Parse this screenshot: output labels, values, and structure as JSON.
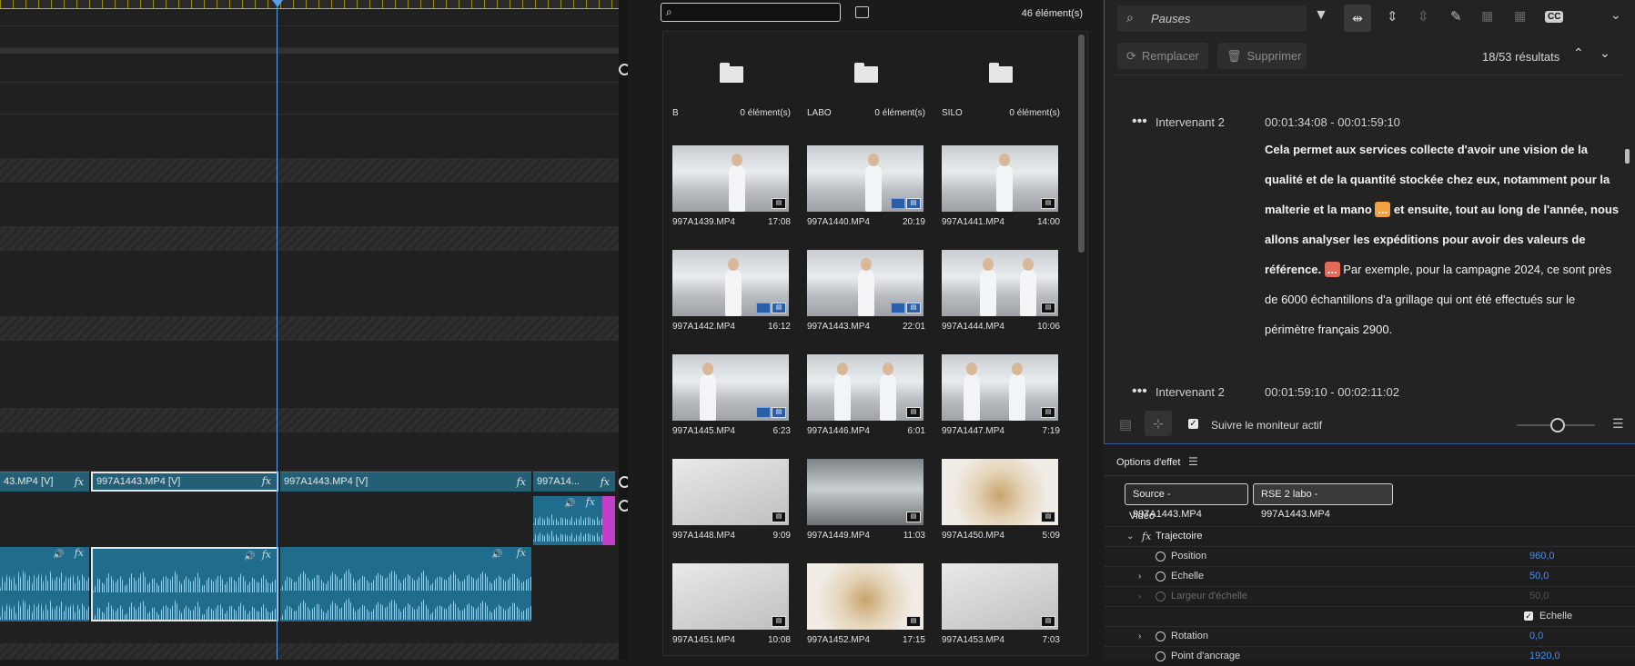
{
  "timeline": {
    "video_clips": [
      {
        "label": "43.MP4 [V]",
        "fx": "fx"
      },
      {
        "label": "997A1443.MP4 [V]",
        "fx": "fx"
      },
      {
        "label": "997A1443.MP4 [V]",
        "fx": "fx"
      },
      {
        "label": "997A14...",
        "fx": "fx"
      }
    ],
    "audio_fx": "fx"
  },
  "bin": {
    "search_placeholder": "",
    "count": "46 élément(s)",
    "folders": [
      {
        "name": "B",
        "count": "0 élément(s)"
      },
      {
        "name": "LABO",
        "count": "0 élément(s)"
      },
      {
        "name": "SILO",
        "count": "0 élément(s)"
      }
    ],
    "clips": [
      {
        "name": "997A1439.MP4",
        "duration": "17:08"
      },
      {
        "name": "997A1440.MP4",
        "duration": "20:19"
      },
      {
        "name": "997A1441.MP4",
        "duration": "14:00"
      },
      {
        "name": "997A1442.MP4",
        "duration": "16:12"
      },
      {
        "name": "997A1443.MP4",
        "duration": "22:01"
      },
      {
        "name": "997A1444.MP4",
        "duration": "10:06"
      },
      {
        "name": "997A1445.MP4",
        "duration": "6:23"
      },
      {
        "name": "997A1446.MP4",
        "duration": "6:01"
      },
      {
        "name": "997A1447.MP4",
        "duration": "7:19"
      },
      {
        "name": "997A1448.MP4",
        "duration": "9:09"
      },
      {
        "name": "997A1449.MP4",
        "duration": "11:03"
      },
      {
        "name": "997A1450.MP4",
        "duration": "5:09"
      },
      {
        "name": "997A1451.MP4",
        "duration": "10:08"
      },
      {
        "name": "997A1452.MP4",
        "duration": "17:15"
      },
      {
        "name": "997A1453.MP4",
        "duration": "7:03"
      }
    ]
  },
  "transcript": {
    "search_value": "Pauses",
    "replace_label": "Remplacer",
    "delete_label": "Supprimer",
    "results": "18/53 résultats",
    "segments": [
      {
        "speaker": "Intervenant 2",
        "time": "00:01:34:08 - 00:01:59:10",
        "part1": "Cela permet aux services collecte d'avoir une vision de la qualité et de la quantité stockée chez eux, notamment pour la malterie et la mano ",
        "pause1": "...",
        "part2": " et ensuite, tout au long de l'année, nous allons analyser les expéditions pour avoir des valeurs de référence. ",
        "pause2": "...",
        "part3": " Par exemple, pour la campagne 2024, ce sont près de 6000 échantillons d'a grillage qui ont été effectués sur le périmètre français 2900."
      },
      {
        "speaker": "Intervenant 2",
        "time": "00:01:59:10 - 00:02:11:02"
      }
    ],
    "follow_label": "Suivre le moniteur actif",
    "cc_label": "CC"
  },
  "effects": {
    "title": "Options d'effet",
    "tab_source": "Source - 997A1443.MP4",
    "tab_sequence": "RSE 2 labo - 997A1443.MP4",
    "section": "Vidéo",
    "effect_name": "Trajectoire",
    "effect_fx": "fx",
    "properties": [
      {
        "label": "Position",
        "value": "960,0"
      },
      {
        "label": "Echelle",
        "value": "50,0"
      },
      {
        "label": "Largeur d'échelle",
        "value": "50,0"
      },
      {
        "label": "Echelle",
        "value": ""
      },
      {
        "label": "Rotation",
        "value": "0,0"
      },
      {
        "label": "Point d'ancrage",
        "value": "1920,0"
      }
    ]
  }
}
